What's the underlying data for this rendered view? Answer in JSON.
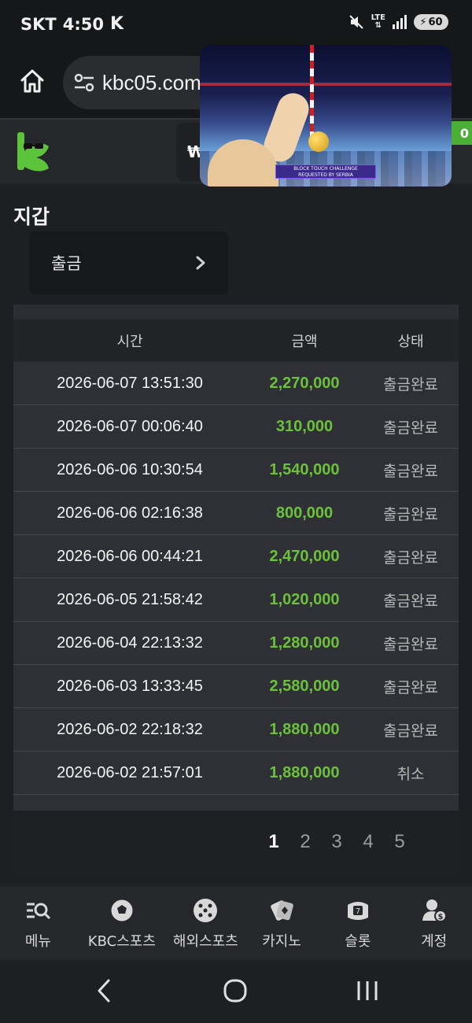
{
  "status_bar": {
    "carrier": "SKT",
    "time": "4:50",
    "app_glyph": "K",
    "network": "LTE",
    "battery": "60",
    "icons": [
      "k-app-icon",
      "mute-icon",
      "lte-icon",
      "signal-icon",
      "battery-charging-icon"
    ]
  },
  "browser": {
    "url": "kbc05.com",
    "icons": [
      "home-icon",
      "site-settings-icon"
    ]
  },
  "pip_video": {
    "banner_line1": "BLOCK TOUCH CHALLENGE",
    "banner_line2": "REQUESTED BY SERBIA"
  },
  "header": {
    "currency_prefix": "₩",
    "badge_text": "0"
  },
  "wallet": {
    "title": "지갑",
    "withdraw_label": "출금"
  },
  "table": {
    "headers": {
      "time": "시간",
      "amount": "금액",
      "status": "상태"
    },
    "rows": [
      {
        "time": "2026-06-07 13:51:30",
        "amount": "2,270,000",
        "status": "출금완료"
      },
      {
        "time": "2026-06-07 00:06:40",
        "amount": "310,000",
        "status": "출금완료"
      },
      {
        "time": "2026-06-06 10:30:54",
        "amount": "1,540,000",
        "status": "출금완료"
      },
      {
        "time": "2026-06-06 02:16:38",
        "amount": "800,000",
        "status": "출금완료"
      },
      {
        "time": "2026-06-06 00:44:21",
        "amount": "2,470,000",
        "status": "출금완료"
      },
      {
        "time": "2026-06-05 21:58:42",
        "amount": "1,020,000",
        "status": "출금완료"
      },
      {
        "time": "2026-06-04 22:13:32",
        "amount": "1,280,000",
        "status": "출금완료"
      },
      {
        "time": "2026-06-03 13:33:45",
        "amount": "2,580,000",
        "status": "출금완료"
      },
      {
        "time": "2026-06-02 22:18:32",
        "amount": "1,880,000",
        "status": "출금완료"
      },
      {
        "time": "2026-06-02 21:57:01",
        "amount": "1,880,000",
        "status": "취소"
      }
    ]
  },
  "pagination": {
    "pages": [
      "1",
      "2",
      "3",
      "4",
      "5"
    ],
    "current": "1"
  },
  "bottom_nav": [
    {
      "label": "메뉴",
      "icon": "menu-search-icon"
    },
    {
      "label": "KBC스포츠",
      "icon": "soccer-ball-icon"
    },
    {
      "label": "해외스포츠",
      "icon": "dice-icon"
    },
    {
      "label": "카지노",
      "icon": "cards-icon"
    },
    {
      "label": "슬롯",
      "icon": "slot-machine-icon"
    },
    {
      "label": "계정",
      "icon": "account-icon"
    }
  ],
  "colors": {
    "amount_green": "#6bc23a",
    "brand_green": "#4caf35",
    "background": "#1e1f23"
  }
}
